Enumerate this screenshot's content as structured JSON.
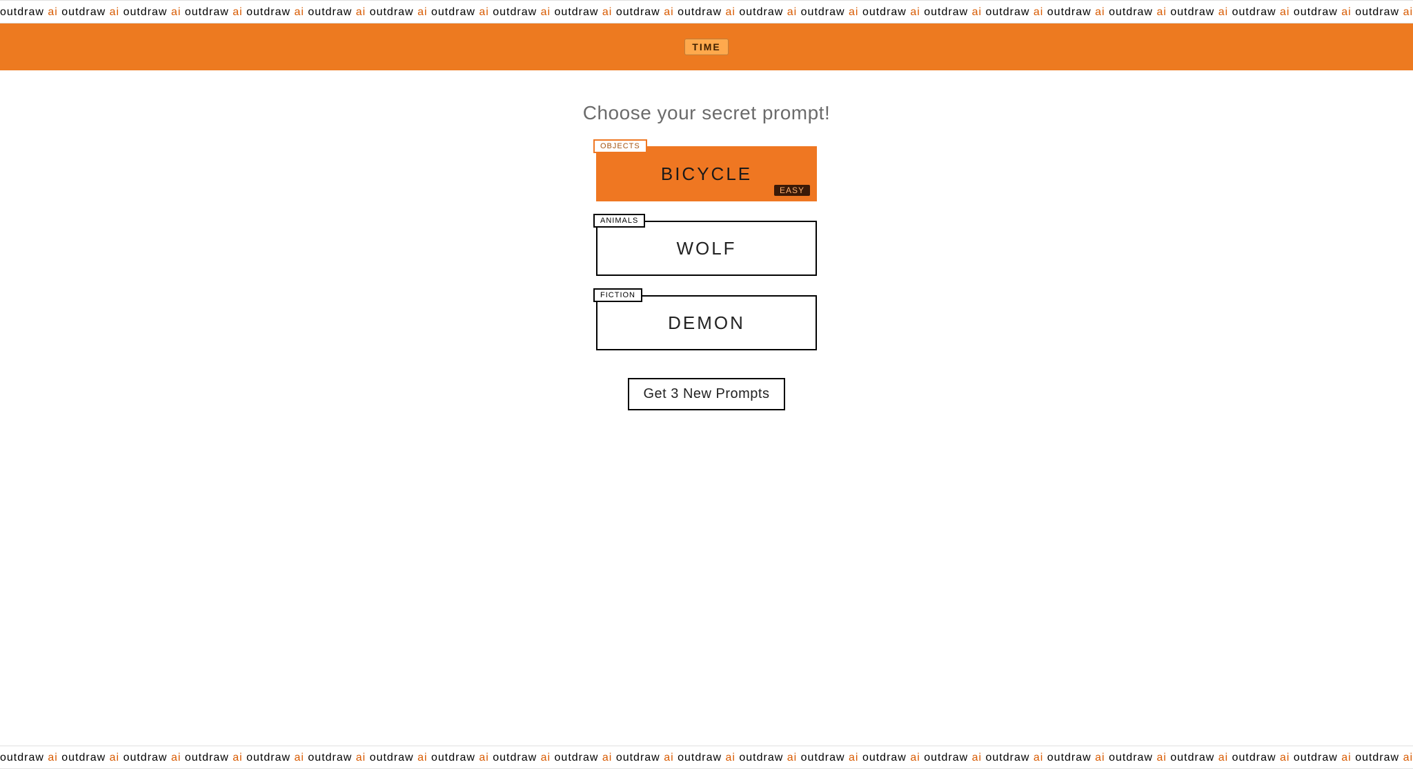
{
  "brand": {
    "word": "outdraw",
    "accent": "ai"
  },
  "header": {
    "title": "TIME"
  },
  "heading": "Choose your secret prompt!",
  "prompts": [
    {
      "category": "OBJECTS",
      "word": "BICYCLE",
      "difficulty": "EASY",
      "selected": true
    },
    {
      "category": "ANIMALS",
      "word": "WOLF",
      "difficulty": "",
      "selected": false
    },
    {
      "category": "FICTION",
      "word": "DEMON",
      "difficulty": "",
      "selected": false
    }
  ],
  "buttons": {
    "new_prompts": "Get 3 New Prompts"
  }
}
